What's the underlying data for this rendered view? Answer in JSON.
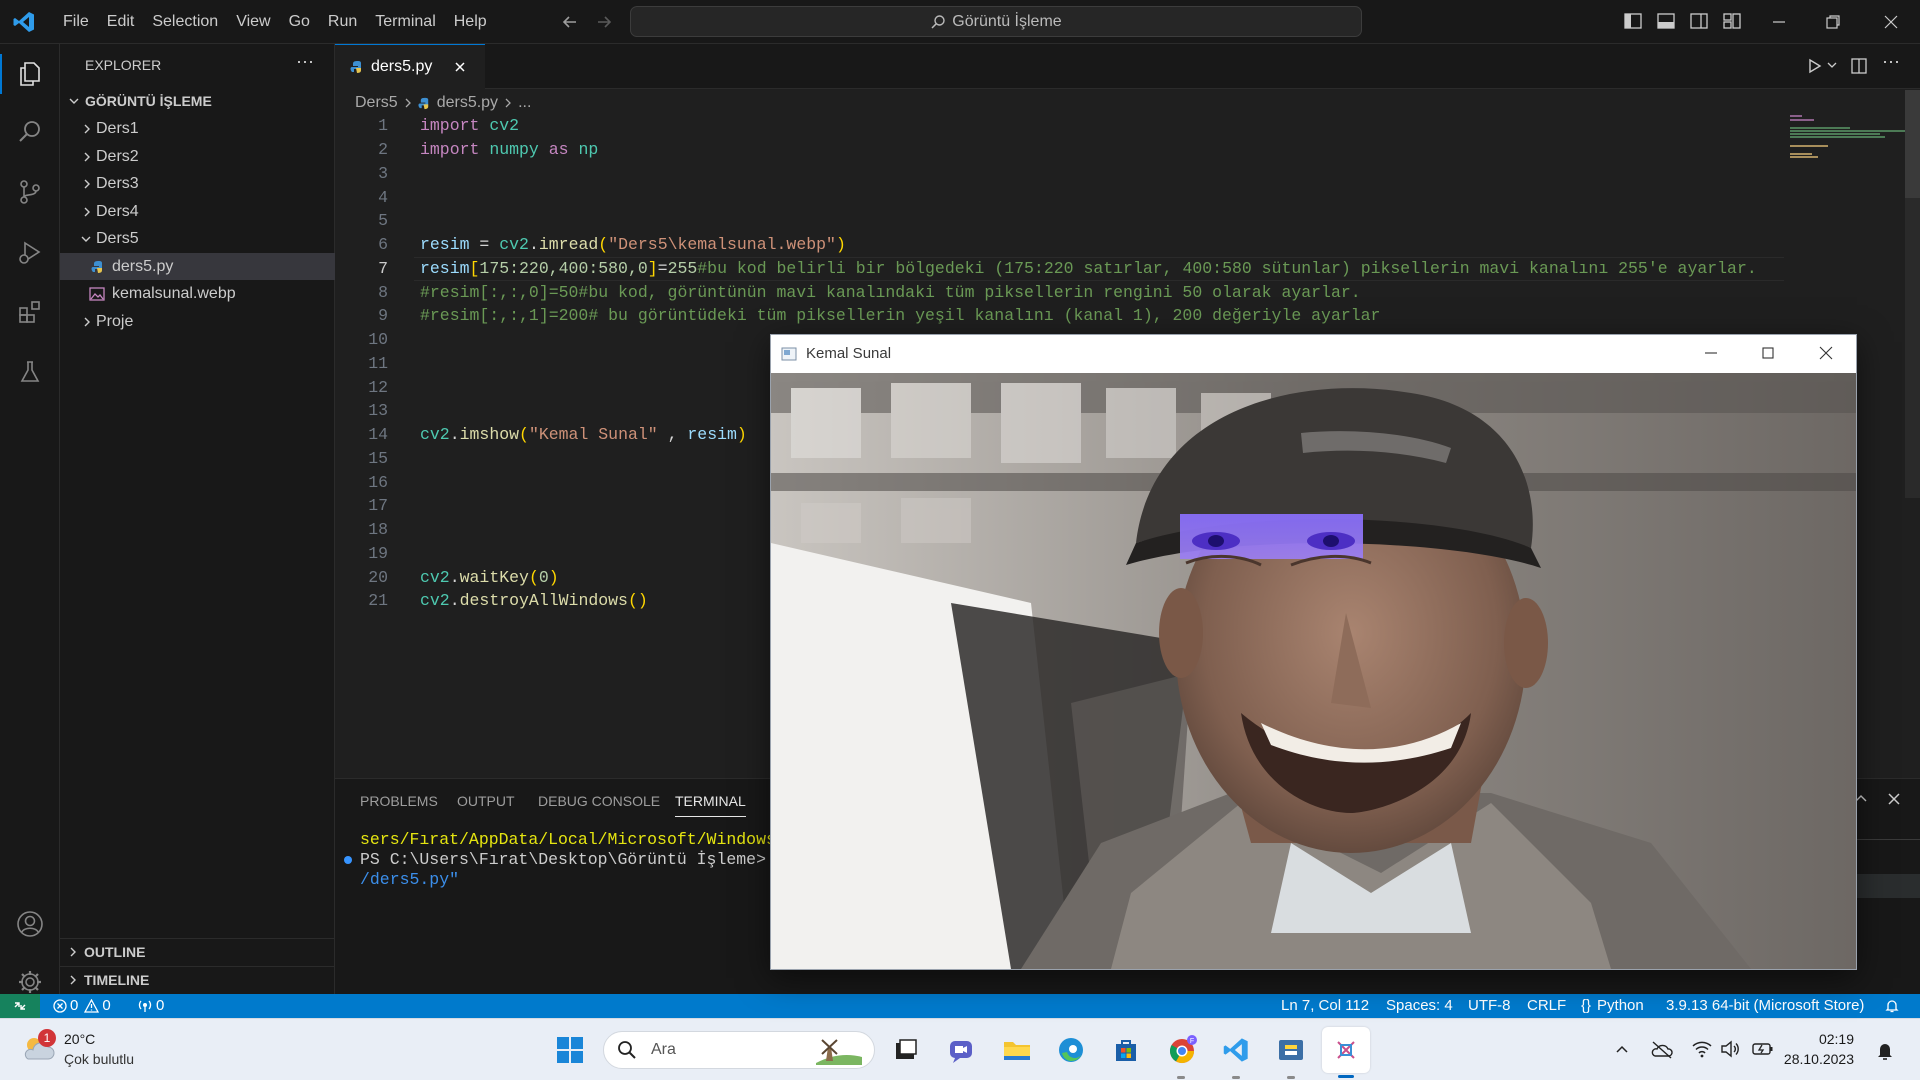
{
  "titlebar": {
    "menu": [
      "File",
      "Edit",
      "Selection",
      "View",
      "Go",
      "Run",
      "Terminal",
      "Help"
    ],
    "search_text": "Görüntü İşleme"
  },
  "explorer": {
    "header": "EXPLORER",
    "folder": "GÖRÜNTÜ İŞLEME",
    "items": [
      {
        "label": "Ders1",
        "type": "folder"
      },
      {
        "label": "Ders2",
        "type": "folder"
      },
      {
        "label": "Ders3",
        "type": "folder"
      },
      {
        "label": "Ders4",
        "type": "folder"
      },
      {
        "label": "Ders5",
        "type": "folder-open"
      },
      {
        "label": "ders5.py",
        "type": "python-file"
      },
      {
        "label": "kemalsunal.webp",
        "type": "image-file"
      },
      {
        "label": "Proje",
        "type": "folder"
      }
    ],
    "outline": "OUTLINE",
    "timeline": "TIMELINE"
  },
  "editor": {
    "tab_label": "ders5.py",
    "breadcrumb": {
      "folder": "Ders5",
      "file": "ders5.py",
      "more": "..."
    },
    "current_line": 7,
    "line_numbers": [
      "1",
      "2",
      "3",
      "4",
      "5",
      "6",
      "7",
      "8",
      "9",
      "10",
      "11",
      "12",
      "13",
      "14",
      "15",
      "16",
      "17",
      "18",
      "19",
      "20",
      "21"
    ],
    "code": {
      "l1": {
        "kw": "import",
        "mod": "cv2"
      },
      "l2": {
        "kw": "import",
        "mod": "numpy",
        "as": "as",
        "alias": "np"
      },
      "l6": {
        "var": "resim",
        "eq": " = ",
        "mod": "cv2",
        "dot": ".",
        "fn": "imread",
        "open": "(",
        "str": "\"Ders5\\kemalsunal.webp\"",
        "close": ")"
      },
      "l7": {
        "var": "resim",
        "open": "[",
        "idx": "175:220,400:580,0",
        "close": "]",
        "eq": "=",
        "num": "255",
        "cm": "#bu kod belirli bir bölgedeki (175:220 satırlar, 400:580 sütunlar) piksellerin mavi kanalını 255'e ayarlar."
      },
      "l8": {
        "cm": "#resim[:,:,0]=50#bu kod, görüntünün mavi kanalındaki tüm piksellerin rengini 50 olarak ayarlar."
      },
      "l9": {
        "cm": "#resim[:,:,1]=200# bu görüntüdeki tüm piksellerin yeşil kanalını (kanal 1), 200 değeriyle ayarlar"
      },
      "l14": {
        "mod": "cv2",
        "dot": ".",
        "fn": "imshow",
        "open": "(",
        "str": "\"Kemal Sunal\"",
        "comma": " , ",
        "var": "resim",
        "close": ")"
      },
      "l20": {
        "mod": "cv2",
        "dot": ".",
        "fn": "waitKey",
        "open": "(",
        "num": "0",
        "close": ")"
      },
      "l21": {
        "mod": "cv2",
        "dot": ".",
        "fn": "destroyAllWindows",
        "parens": "()"
      }
    }
  },
  "panel": {
    "tabs": [
      "PROBLEMS",
      "OUTPUT",
      "DEBUG CONSOLE",
      "TERMINAL"
    ],
    "active_tab": "TERMINAL",
    "terminal_lines": [
      "sers/Fırat/AppData/Local/Microsoft/WindowsApps",
      "PS C:\\Users\\Fırat\\Desktop\\Görüntü İşleme> & C:",
      "/ders5.py\""
    ]
  },
  "image_window": {
    "title": "Kemal Sunal"
  },
  "statusbar": {
    "errors": "0",
    "warnings": "0",
    "ports": "0",
    "position": "Ln 7, Col 112",
    "spaces": "Spaces: 4",
    "encoding": "UTF-8",
    "eol": "CRLF",
    "language": "Python",
    "interpreter": "3.9.13 64-bit (Microsoft Store)"
  },
  "taskbar": {
    "weather_temp": "20°C",
    "weather_text": "Çok bulutlu",
    "weather_badge": "1",
    "search_placeholder": "Ara",
    "time": "02:19",
    "date": "28.10.2023"
  },
  "colors": {
    "accent": "#007acc",
    "editor_bg": "#1f1f1f",
    "sidebar_bg": "#181818",
    "taskbar_bg": "#e9eef6"
  }
}
